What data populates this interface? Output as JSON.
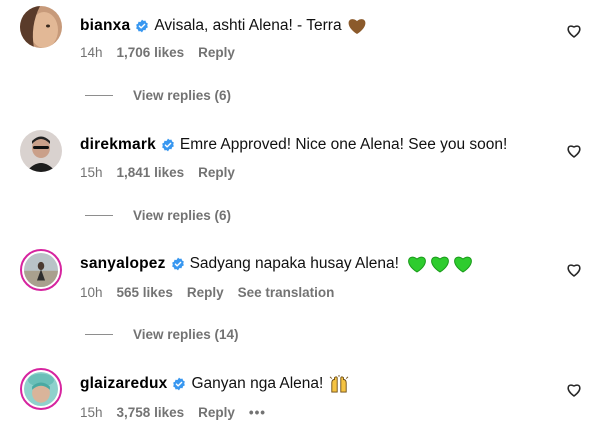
{
  "comments": [
    {
      "username": "bianxa",
      "text": "Avisala, ashti Alena! - Terra",
      "time": "14h",
      "likes": "1,706 likes",
      "reply": "Reply",
      "emoji": [
        "brown-heart"
      ],
      "view_replies": "View replies (6)"
    },
    {
      "username": "direkmark",
      "text": "Emre Approved! Nice one Alena! See you soon!",
      "time": "15h",
      "likes": "1,841 likes",
      "reply": "Reply",
      "view_replies": "View replies (6)"
    },
    {
      "username": "sanyalopez",
      "text": "Sadyang napaka husay Alena!",
      "time": "10h",
      "likes": "565 likes",
      "reply": "Reply",
      "see_translation": "See translation",
      "emoji": [
        "green-heart",
        "green-heart",
        "green-heart"
      ],
      "view_replies": "View replies (14)"
    },
    {
      "username": "glaizaredux",
      "text": "Ganyan nga Alena!",
      "time": "15h",
      "likes": "3,758 likes",
      "reply": "Reply",
      "more": "•••",
      "emoji": [
        "raising-hands"
      ]
    }
  ],
  "colors": {
    "verified": "#3897f0",
    "meta_text": "#737373",
    "story_ring": "#d6249f",
    "green_heart": "#2ecc2e",
    "brown_heart": "#8b5a2b"
  },
  "icons": {
    "verified": "verified-badge-icon",
    "like": "heart-outline-icon"
  }
}
